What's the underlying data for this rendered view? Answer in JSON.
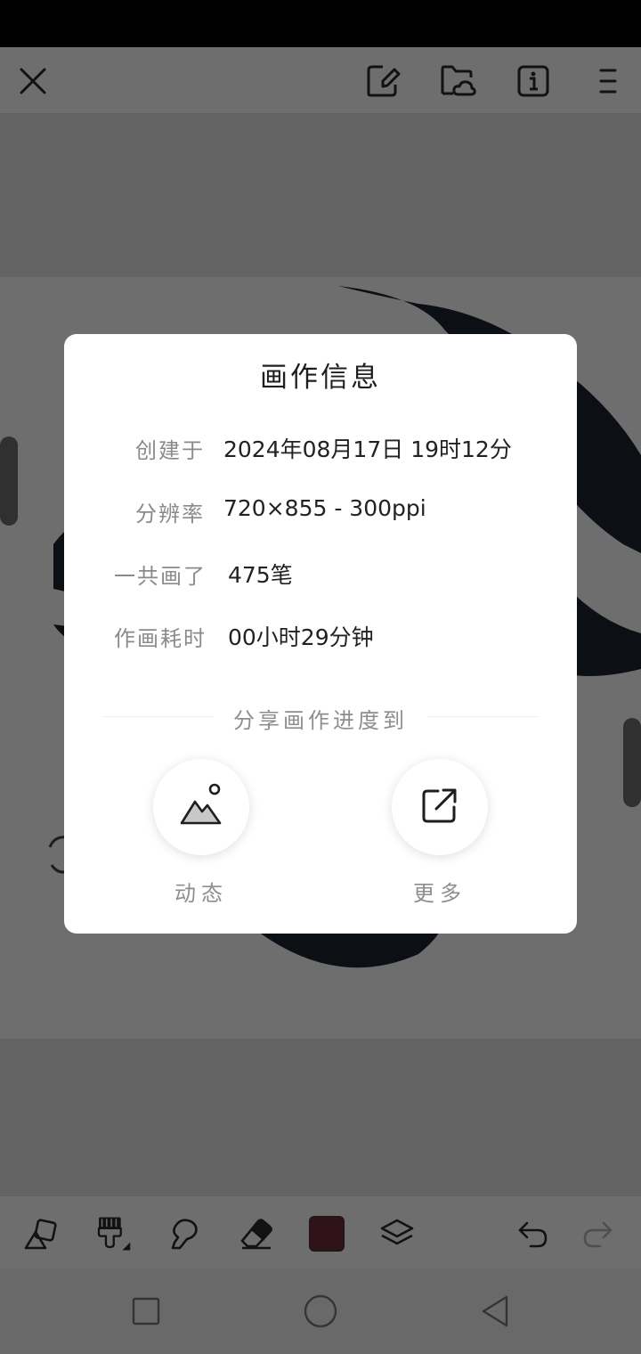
{
  "top_bar": {
    "icons": [
      "close-icon",
      "edit-canvas-icon",
      "cloud-folder-icon",
      "info-icon",
      "menu-icon"
    ]
  },
  "dialog": {
    "title": "画作信息",
    "rows": [
      {
        "label": "创建于",
        "value": "2024年08月17日 19时12分"
      },
      {
        "label": "分辨率",
        "value": "720×855 - 300ppi"
      },
      {
        "label": "一共画了",
        "value": "475笔"
      },
      {
        "label": "作画耗时",
        "value": "00小时29分钟"
      }
    ],
    "share_heading": "分享画作进度到",
    "share_options": [
      {
        "label": "动态",
        "icon": "mountain-sun-icon"
      },
      {
        "label": "更多",
        "icon": "external-share-icon"
      }
    ]
  },
  "toolbar": {
    "tools": [
      "shapes-icon",
      "brush-icon",
      "smudge-icon",
      "eraser-icon",
      "color-swatch",
      "layers-icon",
      "undo-icon",
      "redo-icon"
    ],
    "current_color": "#6e2c38"
  },
  "navigation": {
    "buttons": [
      "recents-button",
      "home-button",
      "back-button"
    ]
  },
  "colors": {
    "scrim": "rgba(0,0,0,0.57)",
    "dialog_background": "#ffffff",
    "status_bar": "#000000"
  }
}
